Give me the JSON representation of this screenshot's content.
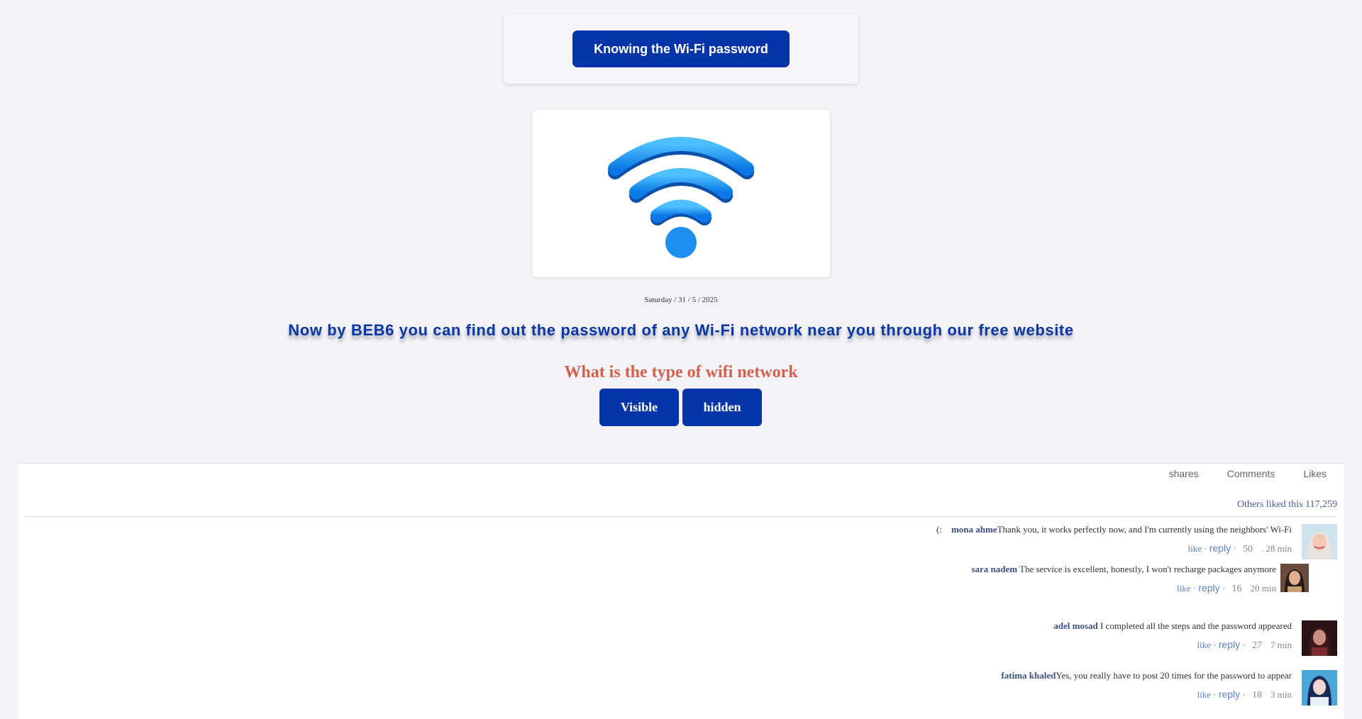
{
  "top_button_label": "Knowing the Wi-Fi password",
  "date": "Saturday / 31 / 5 / 2025",
  "headline": "Now by BEB6 you can find out the password of any Wi-Fi network near you through our free website",
  "question": "What is the type of wifi network",
  "choices": [
    "Visible",
    "hidden"
  ],
  "social": {
    "tabs": [
      "shares",
      "Comments",
      "Likes"
    ],
    "liked_text": "Others liked this 117,259",
    "comments": [
      {
        "prefix": "(:",
        "name": "mona ahme",
        "text": "Thank you, it works perfectly now, and I'm currently using the neighbors' Wi-Fi",
        "like": "like",
        "reply": "reply",
        "count": "50",
        "dot": ".",
        "time": "28 min"
      },
      {
        "prefix": "",
        "name": "sara nadem",
        "text": " The service is excellent, honestly, I won't recharge packages anymore",
        "like": "like",
        "reply": "reply",
        "count": "16",
        "dot": "",
        "time": "20 min"
      },
      {
        "prefix": "",
        "name": "adel mosad",
        "text": " I completed all the steps and the password appeared",
        "like": "like",
        "reply": "reply",
        "count": "27",
        "dot": "",
        "time": "7 min"
      },
      {
        "prefix": "",
        "name": "fatima khaled",
        "text": "Yes, you really have to post 20 times for the password to appear",
        "like": "like",
        "reply": "reply",
        "count": "18",
        "dot": "",
        "time": "3 min"
      }
    ]
  },
  "colors": {
    "brand_blue": "#0535a8",
    "question_red": "#d4614c",
    "wifi_blue": "#1e8ef0"
  }
}
